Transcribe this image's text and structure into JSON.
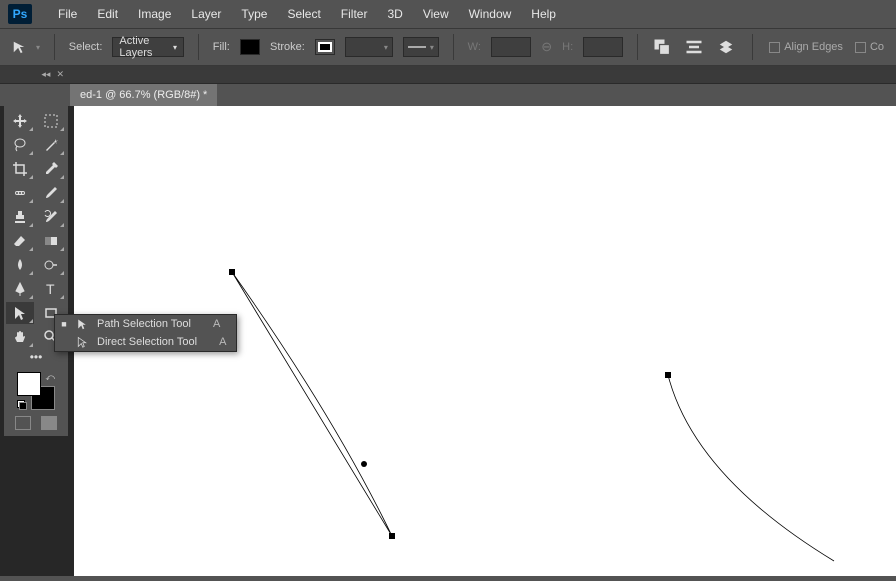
{
  "app": {
    "logo": "Ps"
  },
  "menu": [
    "File",
    "Edit",
    "Image",
    "Layer",
    "Type",
    "Select",
    "Filter",
    "3D",
    "View",
    "Window",
    "Help"
  ],
  "options": {
    "select_label": "Select:",
    "select_value": "Active Layers",
    "fill_label": "Fill:",
    "stroke_label": "Stroke:",
    "w_label": "W:",
    "h_label": "H:",
    "align_edges": "Align Edges",
    "co": "Co"
  },
  "document": {
    "tab": "ed-1 @ 66.7% (RGB/8#) *"
  },
  "flyout": {
    "items": [
      {
        "label": "Path Selection Tool",
        "shortcut": "A",
        "active": true,
        "icon": "black"
      },
      {
        "label": "Direct Selection Tool",
        "shortcut": "A",
        "active": false,
        "icon": "white"
      }
    ]
  }
}
